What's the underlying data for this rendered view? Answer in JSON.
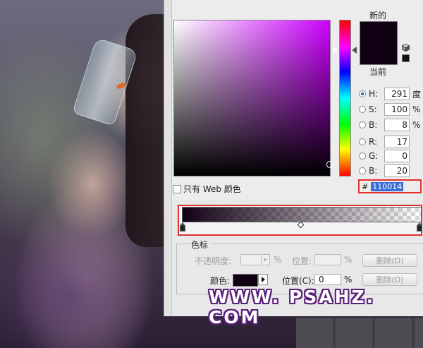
{
  "picker": {
    "new_label": "新的",
    "current_label": "当前",
    "new_color": "#110014",
    "current_color": "#110014",
    "hue_gradient_top_color": "#cc00ff",
    "web_only_label": "只有 Web 颜色",
    "fields": [
      {
        "key": "H:",
        "value": "291",
        "unit": "度",
        "selected": true
      },
      {
        "key": "S:",
        "value": "100",
        "unit": "%",
        "selected": false
      },
      {
        "key": "B:",
        "value": "8",
        "unit": "%",
        "selected": false
      },
      {
        "key": "R:",
        "value": "17",
        "unit": "",
        "selected": false
      },
      {
        "key": "G:",
        "value": "0",
        "unit": "",
        "selected": false
      },
      {
        "key": "B:",
        "value": "20",
        "unit": "",
        "selected": false
      }
    ],
    "hex_prefix": "#",
    "hex_value": "110014",
    "highlight_color": "#e03030"
  },
  "gradient_editor": {
    "gradient_start_color": "#110014",
    "group_title": "色标",
    "opacity_label": "不透明度:",
    "opacity_unit": "%",
    "position_label_1": "位置:",
    "position_unit_1": "%",
    "delete_label_1": "删除(D)",
    "color_label": "颜色:",
    "position_label_2": "位置(C):",
    "position_value_2": "0",
    "position_unit_2": "%",
    "delete_label_2": "删除(D)"
  },
  "watermark": {
    "text": "WWW. PSAHZ. COM"
  }
}
